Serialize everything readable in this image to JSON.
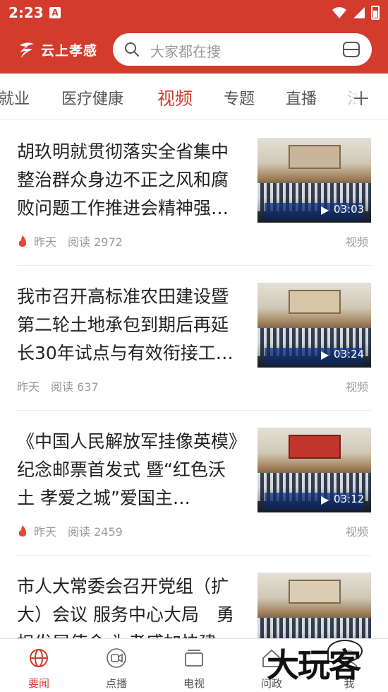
{
  "status_bar": {
    "time": "2:23",
    "app_badge": "A"
  },
  "header": {
    "logo_text": "云上孝感",
    "search_placeholder": "大家都在搜"
  },
  "tabs": [
    {
      "label": "就业",
      "active": false
    },
    {
      "label": "医疗健康",
      "active": false
    },
    {
      "label": "视频",
      "active": true
    },
    {
      "label": "专题",
      "active": false
    },
    {
      "label": "直播",
      "active": false
    },
    {
      "label": "法",
      "active": false
    }
  ],
  "feed": [
    {
      "title": "胡玖明就贯彻落实全省集中整治群众身边不正之风和腐败问题工作推进会精神强…",
      "time": "昨天",
      "reads": "阅读 2972",
      "tag": "视频",
      "duration": "03:03",
      "hot": true
    },
    {
      "title": "我市召开高标准农田建设暨第二轮土地承包到期后再延长30年试点与有效衔接工…",
      "time": "昨天",
      "reads": "阅读 637",
      "tag": "视频",
      "duration": "03:24",
      "hot": false
    },
    {
      "title": "《中国人民解放军挂像英模》纪念邮票首发式 暨“红色沃土 孝爱之城”爱国主…",
      "time": "昨天",
      "reads": "阅读 2459",
      "tag": "视频",
      "duration": "03:12",
      "hot": true
    },
    {
      "title": "市人大常委会召开党组（扩大）会议 服务中心大局　勇担发展使命 为孝感加快建",
      "time": "",
      "reads": "",
      "tag": "",
      "duration": "",
      "hot": false
    }
  ],
  "bottom_nav": [
    {
      "label": "要闻",
      "icon": "globe-icon",
      "active": true
    },
    {
      "label": "点播",
      "icon": "video-camera-icon",
      "active": false
    },
    {
      "label": "电视",
      "icon": "tv-icon",
      "active": false
    },
    {
      "label": "问政",
      "icon": "home-icon",
      "active": false
    },
    {
      "label": "我",
      "icon": "user-icon",
      "active": false
    }
  ],
  "watermark": "大玩客",
  "colors": {
    "brand": "#d33b2c",
    "text": "#222222",
    "muted": "#9a9a9a"
  }
}
